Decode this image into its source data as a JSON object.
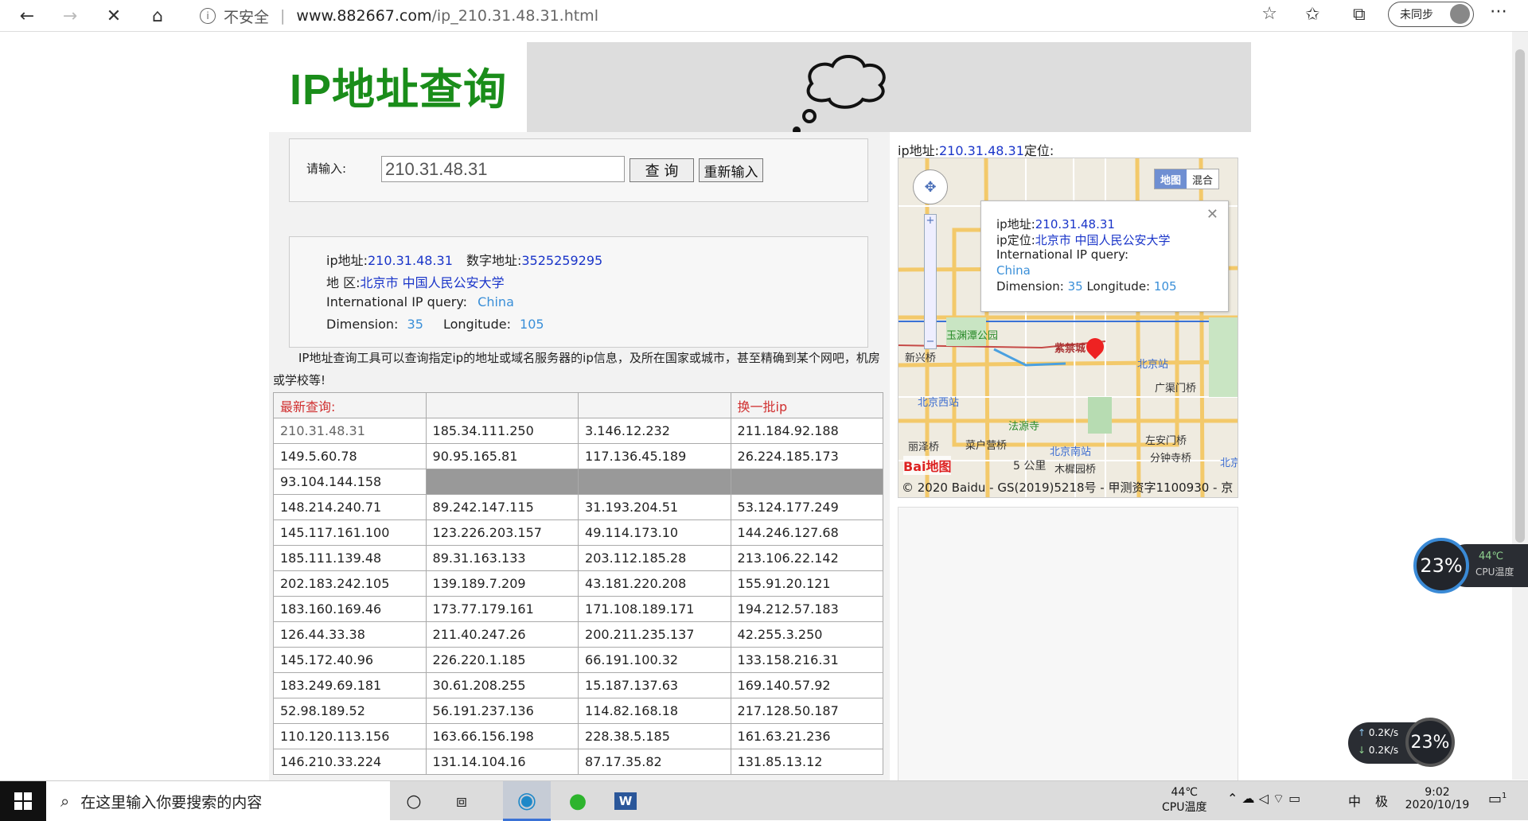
{
  "browser": {
    "security_label": "不安全",
    "url_domain": "www.882667.com",
    "url_path": "/ip_210.31.48.31.html",
    "sync_label": "未同步"
  },
  "page": {
    "logo": "IP地址查询",
    "search": {
      "label": "请输入:",
      "value": "210.31.48.31",
      "query_button": "查  询",
      "reset_button": "重新输入"
    },
    "info": {
      "ip_label": "ip地址:",
      "ip_value": "210.31.48.31",
      "num_label": "数字地址:",
      "num_value": "3525259295",
      "region_label": "地 区:",
      "region_value": "北京市 中国人民公安大学",
      "intl_label": "International IP query:",
      "intl_value": "China",
      "dim_label": "Dimension:",
      "dim_value": "35",
      "lon_label": "Longitude:",
      "lon_value": "105"
    },
    "description": "IP地址查询工具可以查询指定ip的地址或域名服务器的ip信息，及所在国家或城市，甚至精确到某个网吧，机房或学校等!",
    "table": {
      "header_left": "最新查询:",
      "header_right": "换一批ip",
      "rows": [
        [
          "210.31.48.31",
          "185.34.111.250",
          "3.146.12.232",
          "211.184.92.188"
        ],
        [
          "149.5.60.78",
          "90.95.165.81",
          "117.136.45.189",
          "26.224.185.173"
        ],
        [
          "93.104.144.158",
          "",
          "",
          ""
        ],
        [
          "148.214.240.71",
          "89.242.147.115",
          "31.193.204.51",
          "53.124.177.249"
        ],
        [
          "145.117.161.100",
          "123.226.203.157",
          "49.114.173.10",
          "144.246.127.68"
        ],
        [
          "185.111.139.48",
          "89.31.163.133",
          "203.112.185.28",
          "213.106.22.142"
        ],
        [
          "202.183.242.105",
          "139.189.7.209",
          "43.181.220.208",
          "155.91.20.121"
        ],
        [
          "183.160.169.46",
          "173.77.179.161",
          "171.108.189.171",
          "194.212.57.183"
        ],
        [
          "126.44.33.38",
          "211.40.247.26",
          "200.211.235.137",
          "42.255.3.250"
        ],
        [
          "145.172.40.96",
          "226.220.1.185",
          "66.191.100.32",
          "133.158.216.31"
        ],
        [
          "183.249.69.181",
          "30.61.208.255",
          "15.187.137.63",
          "169.140.57.92"
        ],
        [
          "52.98.189.52",
          "56.191.237.136",
          "114.82.168.18",
          "217.128.50.187"
        ],
        [
          "110.120.113.156",
          "163.66.156.198",
          "228.38.5.185",
          "161.63.21.236"
        ],
        [
          "146.210.33.224",
          "131.14.104.16",
          "87.17.35.82",
          "131.85.13.12"
        ]
      ]
    },
    "map": {
      "title_label": "ip地址:",
      "title_ip": "210.31.48.31",
      "title_suffix": "定位:",
      "tab_map": "地图",
      "tab_hybrid": "混合",
      "popup": {
        "ip_label": "ip地址:",
        "ip_value": "210.31.48.31",
        "loc_label": "ip定位:",
        "loc_value": "北京市 中国人民公安大学",
        "intl_label": "International IP query:",
        "intl_value": "China",
        "dim_label": "Dimension:",
        "dim_value": "35",
        "lon_label": "Longitude:",
        "lon_value": "105"
      },
      "labels": {
        "park": "玉渊潭公园",
        "xinxing": "新兴桥",
        "bj_station": "北京站",
        "guangqu": "广渠门桥",
        "bj_west": "北京西站",
        "fayuan": "法源寺",
        "lize": "丽泽桥",
        "caihu": "菜户营桥",
        "bj_south": "北京南站",
        "zuoan": "左安门桥",
        "fenzhong": "分钟寺桥",
        "muxi": "木樨园桥",
        "scale": "5 公里",
        "jingu": "紫禁城",
        "beijing": "北京"
      },
      "logo": "Bai地图",
      "copyright": "© 2020 Baidu - GS(2019)5218号 - 甲测资字1100930 - 京"
    }
  },
  "widgets": {
    "cpu_percent": "23%",
    "cpu_temp": "44℃",
    "cpu_temp_label": "CPU温度",
    "net_up": "0.2K/s",
    "net_down": "0.2K/s",
    "net_percent": "23%"
  },
  "taskbar": {
    "search_placeholder": "在这里输入你要搜索的内容",
    "temp": "44℃",
    "temp_label": "CPU温度",
    "ime1": "中",
    "ime2": "极",
    "time": "9:02",
    "date": "2020/10/19",
    "notif_count": "1"
  }
}
